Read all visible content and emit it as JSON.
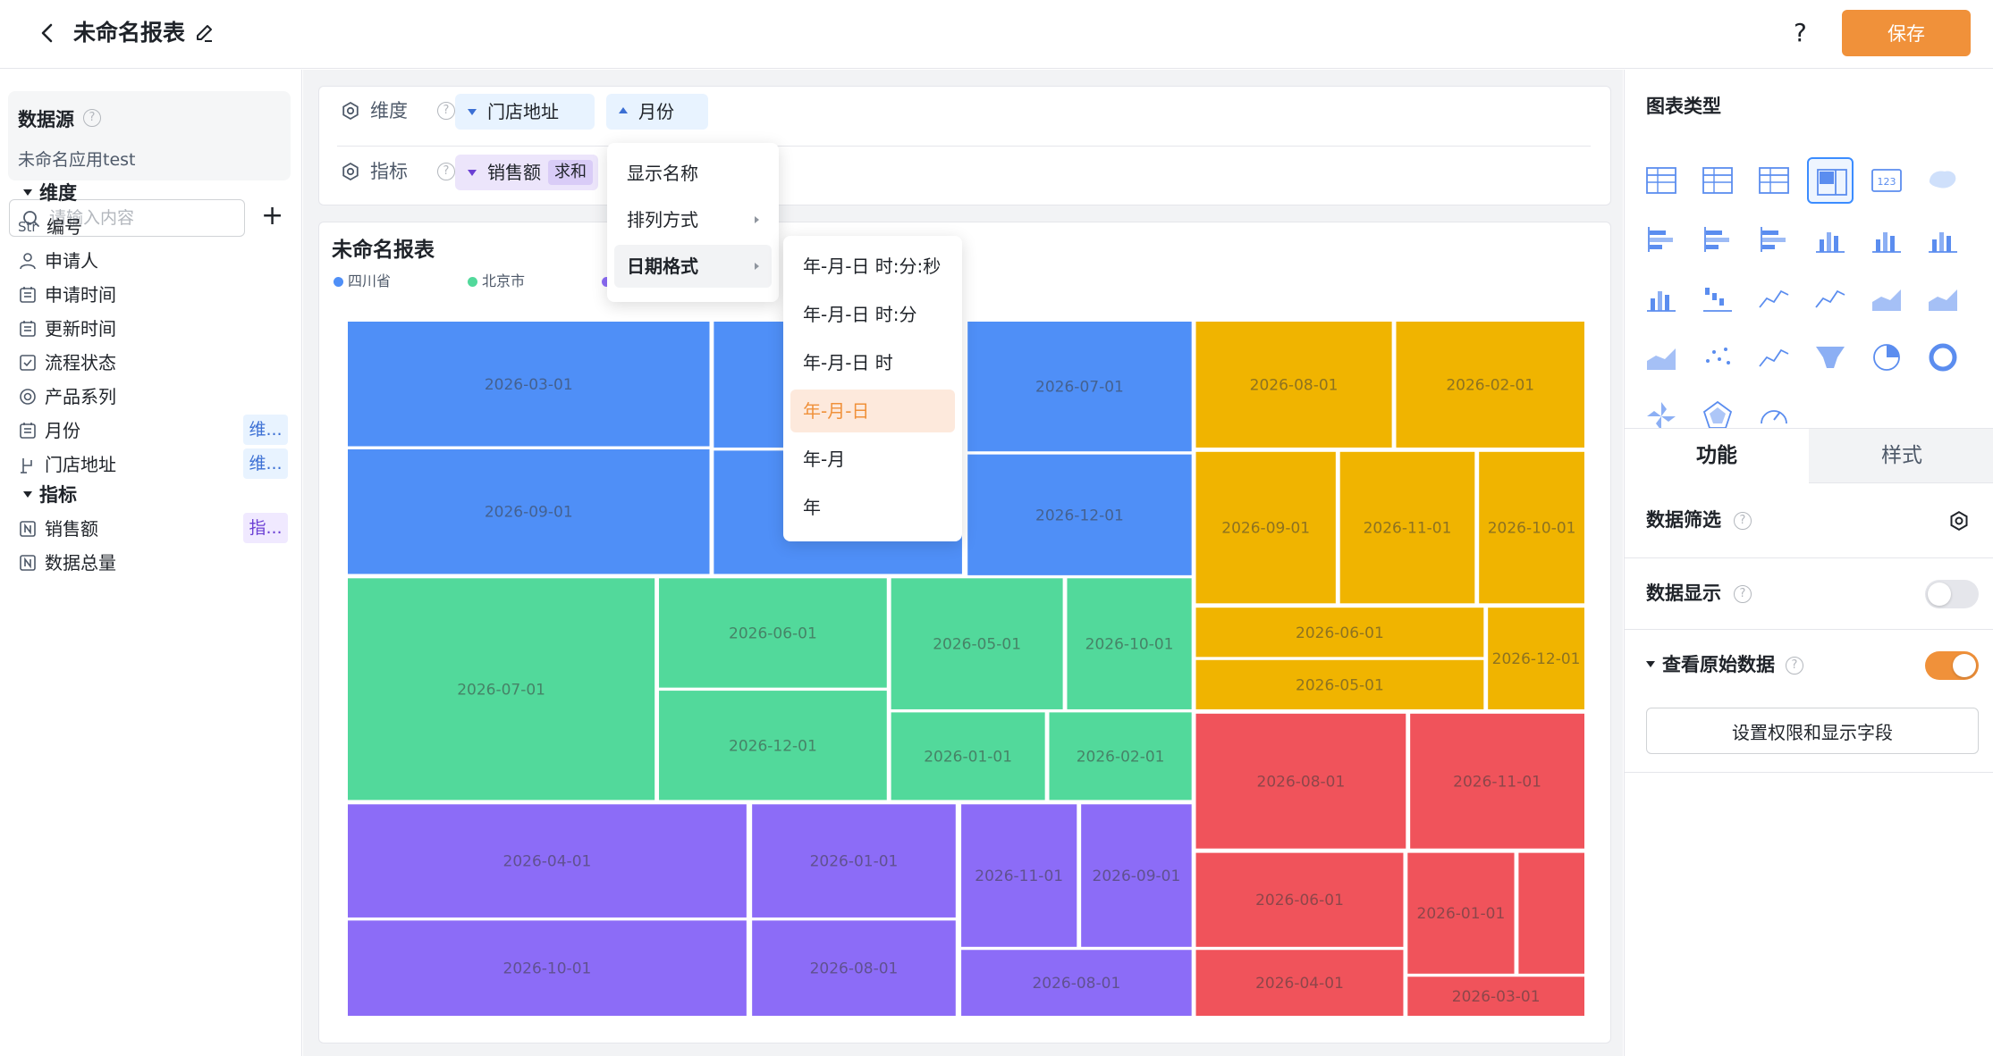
{
  "header": {
    "title": "未命名报表",
    "help": "?",
    "save_label": "保存"
  },
  "left": {
    "datasource_label": "数据源",
    "datasource_name": "未命名应用test",
    "search_placeholder": "请输入内容",
    "add": "+",
    "dimension_group": "维度",
    "metric_group": "指标",
    "dimensions": [
      {
        "icon": "Str",
        "label": "编号",
        "badge": ""
      },
      {
        "icon": "person-icon",
        "label": "申请人",
        "badge": ""
      },
      {
        "icon": "calendar-icon",
        "label": "申请时间",
        "badge": ""
      },
      {
        "icon": "calendar-icon",
        "label": "更新时间",
        "badge": ""
      },
      {
        "icon": "checkbox-icon",
        "label": "流程状态",
        "badge": ""
      },
      {
        "icon": "radio-icon",
        "label": "产品系列",
        "badge": ""
      },
      {
        "icon": "calendar-icon",
        "label": "月份",
        "badge": "维..."
      },
      {
        "icon": "location-icon",
        "label": "门店地址",
        "badge": "维..."
      }
    ],
    "metrics": [
      {
        "icon": "number-icon",
        "label": "销售额",
        "badge": "指..."
      },
      {
        "icon": "number-icon",
        "label": "数据总量",
        "badge": ""
      }
    ]
  },
  "config": {
    "dimension_label": "维度",
    "metric_label": "指标",
    "dimension_pills": [
      "门店地址",
      "月份"
    ],
    "metric_pill": "销售额",
    "metric_agg": "求和"
  },
  "field_menu": {
    "items": [
      "显示名称",
      "排列方式",
      "日期格式"
    ]
  },
  "date_menu": {
    "items": [
      "年-月-日 时:分:秒",
      "年-月-日 时:分",
      "年-月-日 时",
      "年-月-日",
      "年-月",
      "年"
    ],
    "selected_index": 3
  },
  "chart": {
    "title": "未命名报表",
    "legend": [
      {
        "name": "四川省",
        "color": "#4f8ff7"
      },
      {
        "name": "北京市",
        "color": "#52d99b"
      },
      {
        "name": "",
        "color": "#8c6cf7"
      }
    ]
  },
  "chart_data": {
    "type": "treemap",
    "title": "未命名报表",
    "colors": {
      "blue": "#4f8ff7",
      "green": "#52d99b",
      "purple": "#8c6cf7",
      "yellow": "#f0b400",
      "red": "#f0535b"
    },
    "groups": [
      {
        "name": "四川省",
        "color": "blue",
        "cells": [
          "2026-03-01",
          "2026-09-01",
          "",
          "",
          "2026-07-01",
          "2026-12-01"
        ]
      },
      {
        "name": "北京市",
        "color": "green",
        "cells": [
          "2026-07-01",
          "2026-06-01",
          "2026-12-01",
          "2026-05-01",
          "2026-10-01",
          "2026-01-01",
          "2026-02-01"
        ]
      },
      {
        "name": "",
        "color": "purple",
        "cells": [
          "2026-04-01",
          "2026-10-01",
          "2026-08-01",
          "2026-01-01",
          "2026-11-01",
          "2026-09-01",
          "2026-08-01"
        ]
      },
      {
        "name": "",
        "color": "yellow",
        "cells": [
          "2026-08-01",
          "2026-02-01",
          "2026-09-01",
          "2026-11-01",
          "2026-10-01",
          "2026-06-01",
          "2026-05-01",
          "2026-12-01"
        ]
      },
      {
        "name": "",
        "color": "red",
        "cells": [
          "2026-08-01",
          "2026-11-01",
          "2026-06-01",
          "2026-01-01",
          "",
          "2026-04-01",
          "2026-03-01"
        ]
      }
    ]
  },
  "right": {
    "chart_type_title": "图表类型",
    "selected_chart_index": 3,
    "chart_type_label_123": "123",
    "tab_function": "功能",
    "tab_style": "样式",
    "data_filter": "数据筛选",
    "data_display": "数据显示",
    "raw_data": "查看原始数据",
    "raw_data_button": "设置权限和显示字段",
    "data_display_on": false,
    "raw_data_on": true,
    "toggle_on_color": "#f0913a",
    "toggle_off_color": "#e5e6eb"
  }
}
